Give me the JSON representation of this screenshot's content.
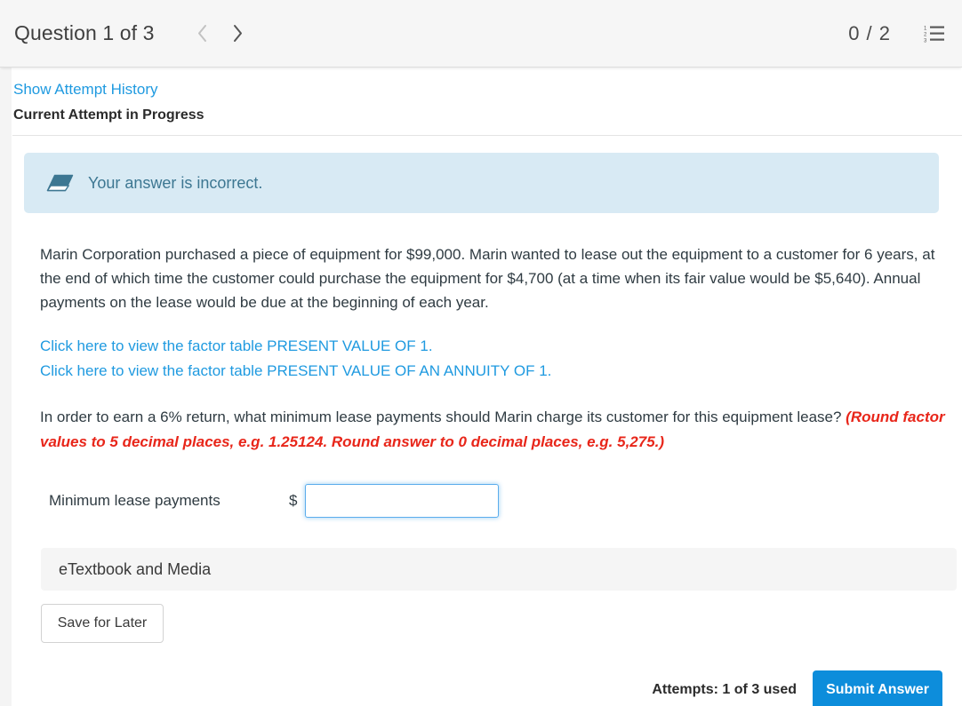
{
  "header": {
    "question_title": "Question 1 of 3",
    "prev_icon": "chevron-left-icon",
    "next_icon": "chevron-right-icon",
    "score": "0 / 2",
    "list_icon": "numbered-list-icon"
  },
  "attempt": {
    "show_history_link": "Show Attempt History",
    "current_attempt": "Current Attempt in Progress"
  },
  "alert": {
    "icon": "eraser-icon",
    "message": "Your answer is incorrect.",
    "background_color": "#d8eaf4",
    "text_color": "#3d7792"
  },
  "question": {
    "body": "Marin Corporation purchased a piece of equipment for $99,000. Marin wanted to lease out the equipment to a customer for 6 years, at the end of which time the customer could purchase the equipment for $4,700 (at a time when its fair value would be $5,640). Annual payments on the lease would be due at the beginning of each year.",
    "factor_link_1": "Click here to view the factor table PRESENT VALUE OF 1.",
    "factor_link_2": "Click here to view the factor table PRESENT VALUE OF AN ANNUITY OF 1.",
    "prompt": "In order to earn a 6% return, what minimum lease payments should Marin charge its customer for this equipment lease?",
    "rounding_note": "(Round factor values to 5 decimal places, e.g. 1.25124. Round answer to 0 decimal places, e.g. 5,275.)",
    "rounding_note_color": "#e8261a"
  },
  "answer": {
    "label": "Minimum lease payments",
    "currency_symbol": "$",
    "value": "",
    "placeholder": ""
  },
  "etextbook": {
    "label": "eTextbook and Media"
  },
  "footer": {
    "save_label": "Save for Later",
    "attempts_text": "Attempts: 1 of 3 used",
    "submit_label": "Submit Answer",
    "submit_color": "#0d8ddb"
  }
}
